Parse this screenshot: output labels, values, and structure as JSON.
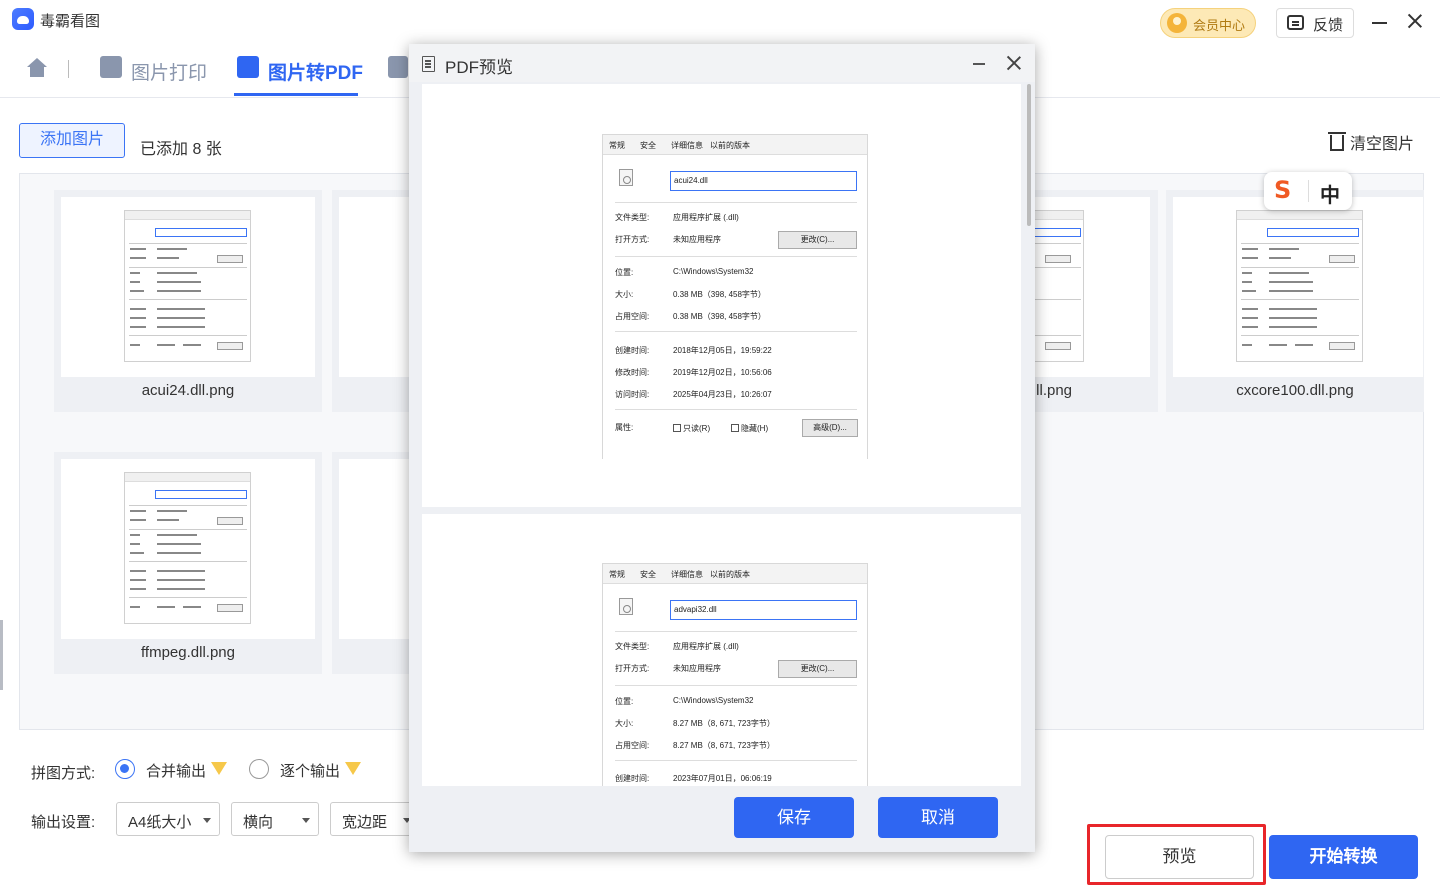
{
  "app": {
    "title": "毒霸看图",
    "vip_label": "会员中心",
    "feedback_label": "反馈"
  },
  "tabs": [
    {
      "label": "图片打印"
    },
    {
      "label": "图片转PDF"
    }
  ],
  "toolbar": {
    "add_label": "添加图片",
    "count_text": "已添加 8 张",
    "clear_label": "清空图片"
  },
  "gallery": {
    "items": [
      {
        "name": "acui24.dll.png"
      },
      {
        "name": ".ll.png"
      },
      {
        "name": "cxcore100.dll.png"
      },
      {
        "name": "ffmpeg.dll.png"
      }
    ]
  },
  "ime": {
    "logo": "S",
    "mode": "中"
  },
  "settings": {
    "merge_label": "拼图方式:",
    "merge_option": "合并输出",
    "single_option": "逐个输出",
    "output_label": "输出设置:",
    "paper": "A4纸大小",
    "orientation": "横向",
    "margin": "宽边距"
  },
  "actions": {
    "preview": "预览",
    "start": "开始转换"
  },
  "modal": {
    "title": "PDF预览",
    "save": "保存",
    "cancel": "取消",
    "tabs": [
      "常规",
      "安全",
      "详细信息",
      "以前的版本"
    ],
    "labels": {
      "type": "文件类型:",
      "open": "打开方式:",
      "location": "位置:",
      "size": "大小:",
      "disk": "占用空间:",
      "created": "创建时间:",
      "modified": "修改时间:",
      "accessed": "访问时间:",
      "attrs": "属性:"
    },
    "change_btn": "更改(C)...",
    "advanced_btn": "高级(D)...",
    "readonly": "只读(R)",
    "hidden": "隐藏(H)",
    "pages": [
      {
        "filename": "acui24.dll",
        "type": "应用程序扩展 (.dll)",
        "open": "未知应用程序",
        "location": "C:\\Windows\\System32",
        "size": "0.38 MB（398, 458字节）",
        "disk": "0.38 MB（398, 458字节）",
        "created": "2018年12月05日，19:59:22",
        "modified": "2019年12月02日，10:56:06",
        "accessed": "2025年04月23日，10:26:07"
      },
      {
        "filename": "advapi32.dll",
        "type": "应用程序扩展 (.dll)",
        "open": "未知应用程序",
        "location": "C:\\Windows\\System32",
        "size": "8.27 MB（8, 671, 723字节）",
        "disk": "8.27 MB（8, 671, 723字节）",
        "created": "2023年07月01日，06:06:19"
      }
    ]
  }
}
